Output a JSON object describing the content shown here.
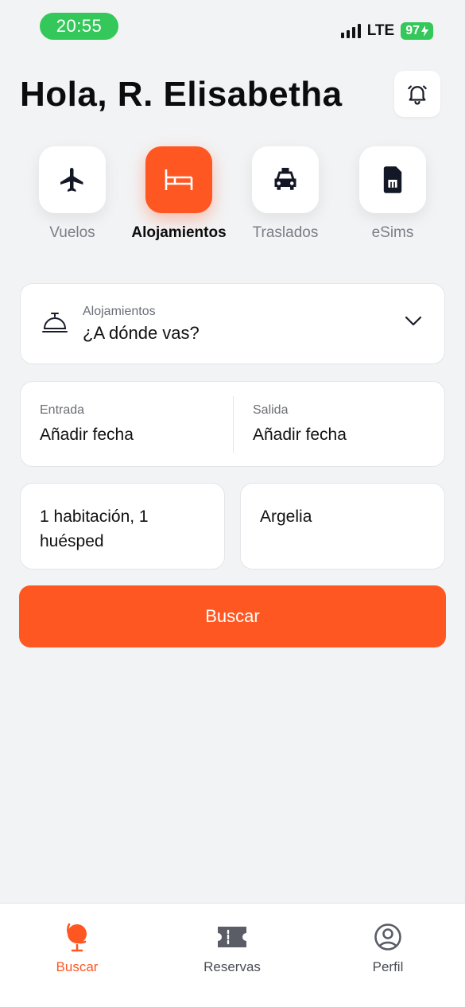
{
  "status_bar": {
    "time": "20:55",
    "network": "LTE",
    "battery": "97",
    "colors": {
      "pill": "#34c759"
    }
  },
  "header": {
    "greeting": "Hola, R. Elisabetha",
    "notification_icon": "bell-icon"
  },
  "categories": [
    {
      "label": "Vuelos",
      "icon": "plane-icon",
      "active": false
    },
    {
      "label": "Alojamientos",
      "icon": "bed-icon",
      "active": true
    },
    {
      "label": "Traslados",
      "icon": "taxi-icon",
      "active": false
    },
    {
      "label": "eSims",
      "icon": "sim-card-icon",
      "active": false
    }
  ],
  "search_form": {
    "destination": {
      "label": "Alojamientos",
      "placeholder": "¿A dónde vas?",
      "icon": "concierge-bell-icon"
    },
    "check_in": {
      "label": "Entrada",
      "value": "Añadir fecha"
    },
    "check_out": {
      "label": "Salida",
      "value": "Añadir fecha"
    },
    "guests": {
      "value": "1 habitación, 1 huésped"
    },
    "country": {
      "value": "Argelia"
    },
    "submit_label": "Buscar"
  },
  "bottom_nav": [
    {
      "label": "Buscar",
      "icon": "globe-icon",
      "active": true
    },
    {
      "label": "Reservas",
      "icon": "ticket-icon",
      "active": false
    },
    {
      "label": "Perfil",
      "icon": "user-circle-icon",
      "active": false
    }
  ],
  "colors": {
    "accent": "#ff5722",
    "background": "#f2f3f5",
    "muted_text": "#7a7d85"
  }
}
